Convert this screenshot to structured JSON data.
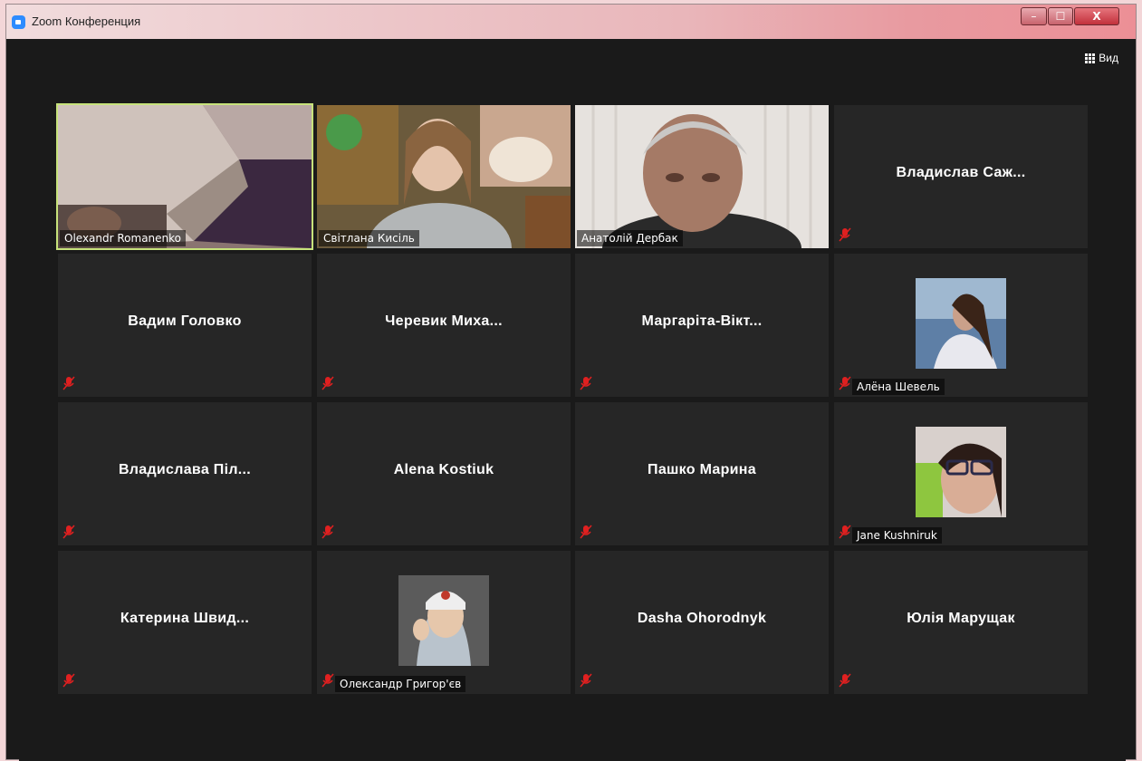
{
  "window": {
    "title": "Zoom Конференция",
    "buttons": {
      "minimize": "–",
      "maximize": "☐",
      "close": "X"
    }
  },
  "toolbar": {
    "view_label": "Вид",
    "view_icon": "grid-icon"
  },
  "colors": {
    "active_speaker_border": "#c7e27b",
    "tile_bg": "#262626",
    "mute_icon": "#e02020"
  },
  "participants": [
    {
      "name": "Olexandr Romanenko",
      "video": true,
      "active": true,
      "muted": false
    },
    {
      "name": "Світлана Кисіль",
      "video": true,
      "muted": false
    },
    {
      "name": "Анатолій Дербак",
      "video": true,
      "muted": false
    },
    {
      "name": "Владислав Саж...",
      "video": false,
      "muted": true
    },
    {
      "name": "Вадим Головко",
      "video": false,
      "muted": true
    },
    {
      "name": "Черевик Миха...",
      "video": false,
      "muted": true
    },
    {
      "name": "Маргаріта-Вікт...",
      "video": false,
      "muted": true
    },
    {
      "name": "Алёна Шевель",
      "avatar": true,
      "muted": true
    },
    {
      "name": "Владислава Піл...",
      "video": false,
      "muted": true
    },
    {
      "name": "Alena Kostiuk",
      "video": false,
      "muted": true
    },
    {
      "name": "Пашко Марина",
      "video": false,
      "muted": true
    },
    {
      "name": "Jane Kushniruk",
      "avatar": true,
      "muted": true
    },
    {
      "name": "Катерина Швид...",
      "video": false,
      "muted": true
    },
    {
      "name": "Олександр Григор'єв",
      "avatar": true,
      "muted": true
    },
    {
      "name": "Dasha Ohorodnyk",
      "video": false,
      "muted": true
    },
    {
      "name": "Юлія Марущак",
      "video": false,
      "muted": true
    }
  ]
}
